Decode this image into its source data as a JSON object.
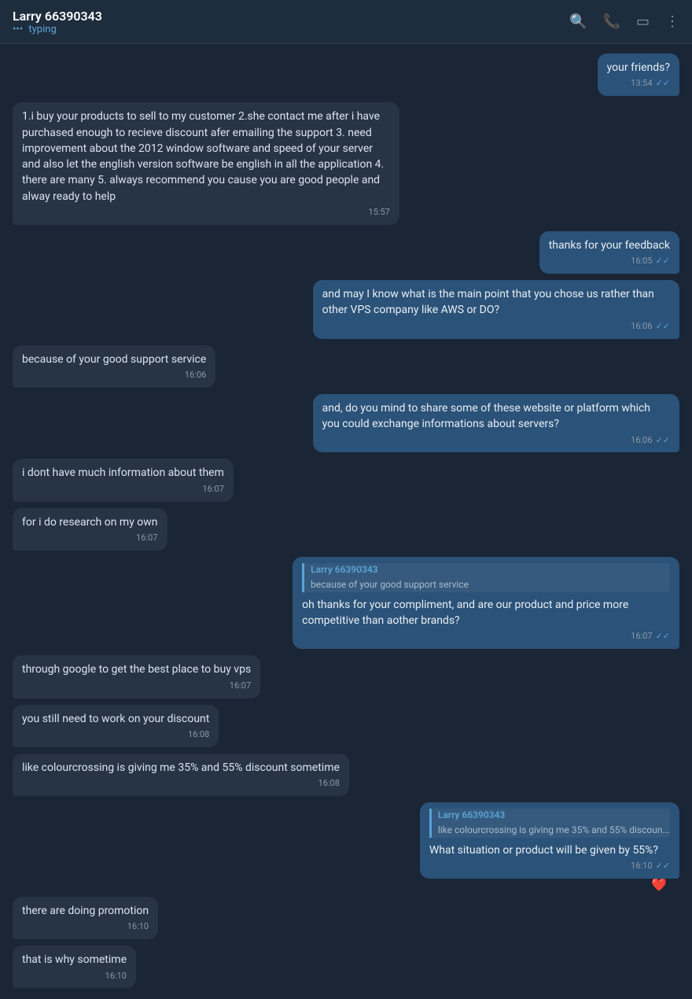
{
  "header": {
    "contact_name": "Larry 66390343",
    "status": "typing",
    "typing_prefix": "•••",
    "icons": [
      "search",
      "phone",
      "sidebar",
      "more"
    ]
  },
  "messages": [
    {
      "id": "msg1",
      "type": "sent",
      "text": "your friends?",
      "time": "13:54",
      "read": true
    },
    {
      "id": "msg2",
      "type": "received",
      "text": "1.i buy your products to sell to my customer 2.she contact me after i have purchased enough to recieve discount afer emailing the support  3. need improvement about the 2012 window software and speed of your server and also let the english version software be english in all the application 4. there are many 5. always recommend you cause you are good people and alway ready to help",
      "time": "15:57",
      "read": false
    },
    {
      "id": "msg3",
      "type": "sent",
      "text": "thanks for your feedback",
      "time": "16:05",
      "read": true
    },
    {
      "id": "msg4",
      "type": "sent",
      "text": "and may I know what is the main point that you chose us rather than other VPS company like AWS or DO?",
      "time": "16:06",
      "read": true
    },
    {
      "id": "msg5",
      "type": "received",
      "text": "because of your good support service",
      "time": "16:06",
      "read": false
    },
    {
      "id": "msg6",
      "type": "sent",
      "text": "and, do you mind to share some of these website or platform which you could exchange informations about servers?",
      "time": "16:06",
      "read": true
    },
    {
      "id": "msg7",
      "type": "received",
      "text": "i dont have much information about them",
      "time": "16:07",
      "read": false
    },
    {
      "id": "msg8",
      "type": "received",
      "text": "for i do research on my own",
      "time": "16:07",
      "read": false
    },
    {
      "id": "msg9",
      "type": "sent",
      "has_quote": true,
      "quote_name": "Larry 66390343",
      "quote_text": "because of your good support service",
      "text": "oh  thanks for your compliment, and are our product and price more competitive than aother brands?",
      "time": "16:07",
      "read": true
    },
    {
      "id": "msg10",
      "type": "received",
      "text": "through google to get the best place to buy vps",
      "time": "16:07",
      "read": false
    },
    {
      "id": "msg11",
      "type": "received",
      "text": "you still need to work on your discount",
      "time": "16:08",
      "read": false
    },
    {
      "id": "msg12",
      "type": "received",
      "text": "like colourcrossing is giving me 35% and 55% discount sometime",
      "time": "16:08",
      "read": false
    },
    {
      "id": "msg13",
      "type": "sent",
      "has_quote": true,
      "quote_name": "Larry 66390343",
      "quote_text": "like colourcrossing is giving me 35% and 55% discoun...",
      "text": "What situation or product will be given by 55%?",
      "time": "16:10",
      "read": true,
      "has_reaction": true,
      "reaction": "❤️"
    },
    {
      "id": "msg14",
      "type": "received",
      "text": "there are doing promotion",
      "time": "16:10",
      "read": false
    },
    {
      "id": "msg15",
      "type": "received",
      "text": "that is why sometime",
      "time": "16:10",
      "read": false
    }
  ]
}
